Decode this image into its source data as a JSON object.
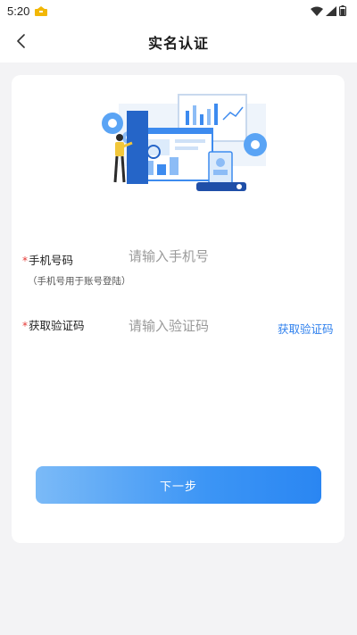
{
  "status_bar": {
    "time": "5:20",
    "icons": [
      "notification-icon",
      "wifi-icon",
      "signal-icon",
      "battery-icon"
    ]
  },
  "header": {
    "title": "实名认证",
    "back_icon": "chevron-left-icon"
  },
  "form": {
    "phone": {
      "required_mark": "*",
      "label": "手机号码",
      "hint": "（手机号用于账号登陆）",
      "placeholder": "请输入手机号",
      "value": ""
    },
    "code": {
      "required_mark": "*",
      "label": "获取验证码",
      "placeholder": "请输入验证码",
      "value": "",
      "get_code_label": "获取验证码"
    },
    "next_label": "下一步"
  },
  "colors": {
    "accent": "#2f80ed",
    "required": "#e53935",
    "background": "#f3f3f5",
    "card": "#ffffff"
  }
}
